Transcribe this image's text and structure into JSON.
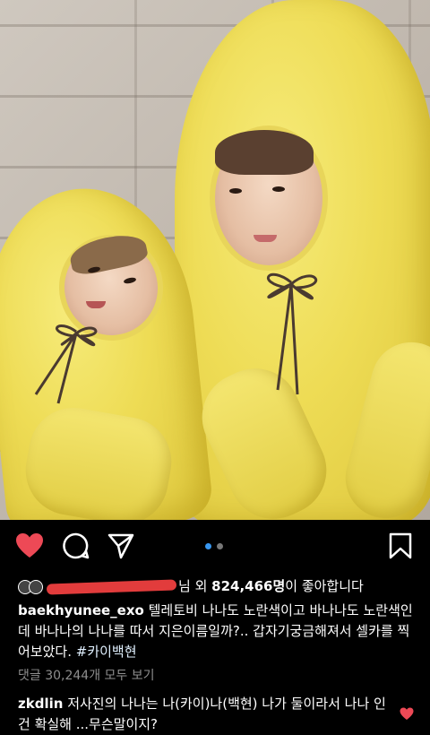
{
  "post": {
    "likes": {
      "suffix": "님 외 ",
      "count": "824,466명",
      "end": "이 좋아합니다"
    },
    "caption": {
      "username": "baekhyunee_exo",
      "text": "텔레토비 나나도 노란색이고 바나나도 노란색인데 바나나의 나나를 따서 지은이름일까?.. 갑자기궁금해져서 셀카를 찍어보았다. ",
      "hashtag": "#카이백현"
    },
    "view_comments": "댓글 30,244개 모두 보기",
    "comment": {
      "username": "zkdlin",
      "text": "저사진의 나나는 나(카이)나(백현) 나가 둘이라서 나나 인건 확실해 ...무슨말이지?"
    },
    "carousel": {
      "pages": 2,
      "current": 1
    },
    "icons": {
      "like": "heart-icon",
      "comment": "comment-icon",
      "share": "share-icon",
      "save": "bookmark-icon",
      "comment_like": "heart-small-icon"
    },
    "colors": {
      "like_active": "#ed4956",
      "carousel_active": "#3897f0",
      "background": "#000000",
      "secondary_text": "#8e8e8e"
    }
  }
}
